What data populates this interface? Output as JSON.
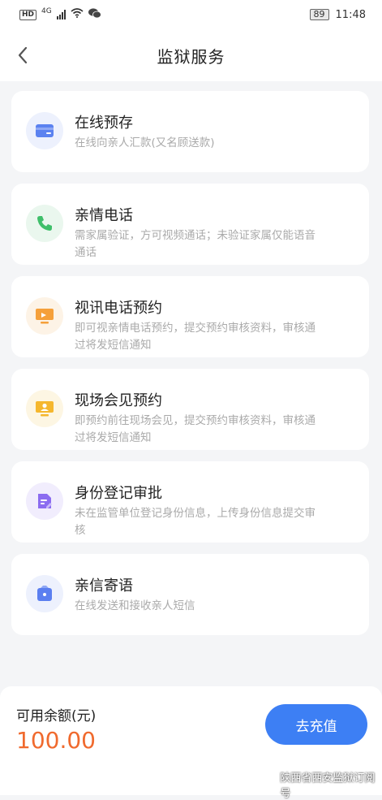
{
  "status_bar": {
    "hd_tag": "HD",
    "network": "4G",
    "battery": "89",
    "time": "11:48"
  },
  "header": {
    "title": "监狱服务"
  },
  "services": [
    {
      "title": "在线预存",
      "desc": "在线向亲人汇款(又名顾送款)",
      "icon": "credit-card-icon",
      "color": "#5b82f0",
      "bg": "#edf1fd"
    },
    {
      "title": "亲情电话",
      "desc": "需家属验证，方可视频通话；未验证家属仅能语音通话",
      "icon": "phone-icon",
      "color": "#3fbf6a",
      "bg": "#eaf7ee"
    },
    {
      "title": "视讯电话预约",
      "desc": "即可视亲情电话预约，提交预约审核资料，审核通过将发短信通知",
      "icon": "monitor-icon",
      "color": "#f5a03a",
      "bg": "#fdf3e6"
    },
    {
      "title": "现场会见预约",
      "desc": "即预约前往现场会见，提交预约审核资料，审核通过将发短信通知",
      "icon": "meeting-icon",
      "color": "#f5b72e",
      "bg": "#fdf6e3"
    },
    {
      "title": "身份登记审批",
      "desc": "未在监管单位登记身份信息，上传身份信息提交审核",
      "icon": "id-document-icon",
      "color": "#8b6cf0",
      "bg": "#f1edfd"
    },
    {
      "title": "亲信寄语",
      "desc": "在线发送和接收亲人短信",
      "icon": "message-icon",
      "color": "#5b7ff0",
      "bg": "#edf1fd"
    }
  ],
  "footer": {
    "balance_label": "可用余额(元)",
    "balance_value": "100.00",
    "recharge_label": "去充值"
  },
  "watermark": {
    "text": "陕西省西安监狱订阅号"
  }
}
